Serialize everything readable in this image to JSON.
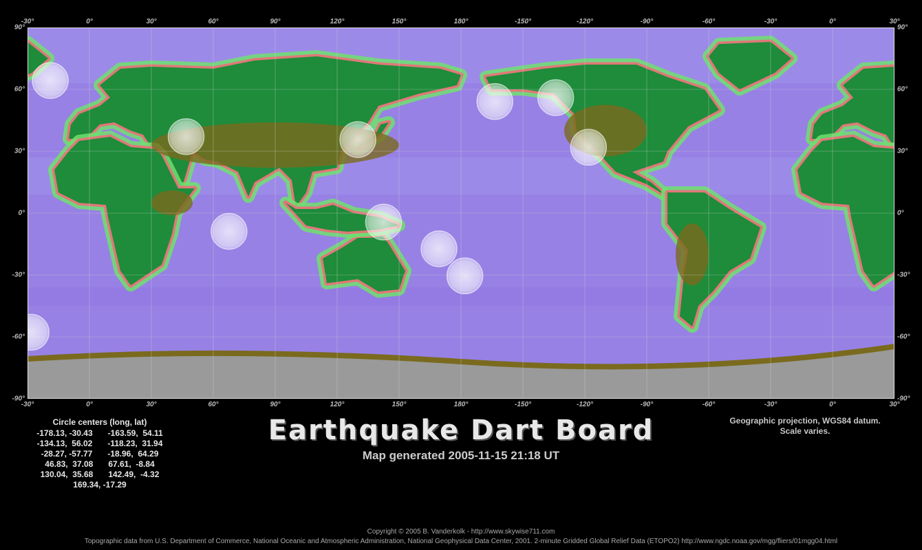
{
  "map": {
    "lon_ticks": [
      "-30°",
      "0°",
      "30°",
      "60°",
      "90°",
      "120°",
      "150°",
      "180°",
      "-150°",
      "-120°",
      "-90°",
      "-60°",
      "-30°",
      "0°",
      "30°"
    ],
    "lat_ticks": [
      "90°",
      "60°",
      "30°",
      "0°",
      "-30°",
      "-60°",
      "-90°"
    ],
    "lon_start": -30,
    "lon_span": 420,
    "colors": {
      "deep_ocean": "#8f6fe0",
      "ocean": "#9c8ae8",
      "shelf": "#6fe06f",
      "coast_shelf": "#e07878",
      "lowland": "#1e8c3a",
      "highland": "#7a6a1e",
      "ice": "#9a9a9a",
      "ring": "#ffffff",
      "grid": "#cfcfcf"
    },
    "circles": [
      {
        "lon": -178.13,
        "lat": -30.43
      },
      {
        "lon": -163.59,
        "lat": 54.11
      },
      {
        "lon": -134.13,
        "lat": 56.02
      },
      {
        "lon": -118.23,
        "lat": 31.94
      },
      {
        "lon": -28.27,
        "lat": -57.77
      },
      {
        "lon": -18.96,
        "lat": 64.29
      },
      {
        "lon": 46.83,
        "lat": 37.08
      },
      {
        "lon": 67.61,
        "lat": -8.84
      },
      {
        "lon": 130.04,
        "lat": 35.68
      },
      {
        "lon": 142.49,
        "lat": -4.32
      },
      {
        "lon": 169.34,
        "lat": -17.29
      }
    ]
  },
  "centers": {
    "header": "Circle centers (long, lat)",
    "rows": [
      [
        "-178.13, -30.43",
        "-163.59,  54.11"
      ],
      [
        "-134.13,  56.02",
        "-118.23,  31.94"
      ],
      [
        "-28.27, -57.77",
        "-18.96,  64.29"
      ],
      [
        "46.83,  37.08",
        "67.61,  -8.84"
      ],
      [
        "130.04,  35.68",
        "142.49,  -4.32"
      ],
      [
        "169.34, -17.29"
      ]
    ]
  },
  "title": "Earthquake Dart Board",
  "generated": "Map generated 2005-11-15 21:18 UT",
  "projection": {
    "line1": "Geographic projection, WGS84 datum.",
    "line2": "Scale varies."
  },
  "footer": {
    "copyright": "Copyright © 2005 B. Vanderkolk - http://www.skywise711.com",
    "source": "Topographic data from U.S. Department of Commerce, National Oceanic and Atmospheric Administration, National Geophysical Data Center, 2001. 2-minute Gridded Global Relief Data (ETOPO2) http://www.ngdc.noaa.gov/mgg/fliers/01mgg04.html"
  }
}
